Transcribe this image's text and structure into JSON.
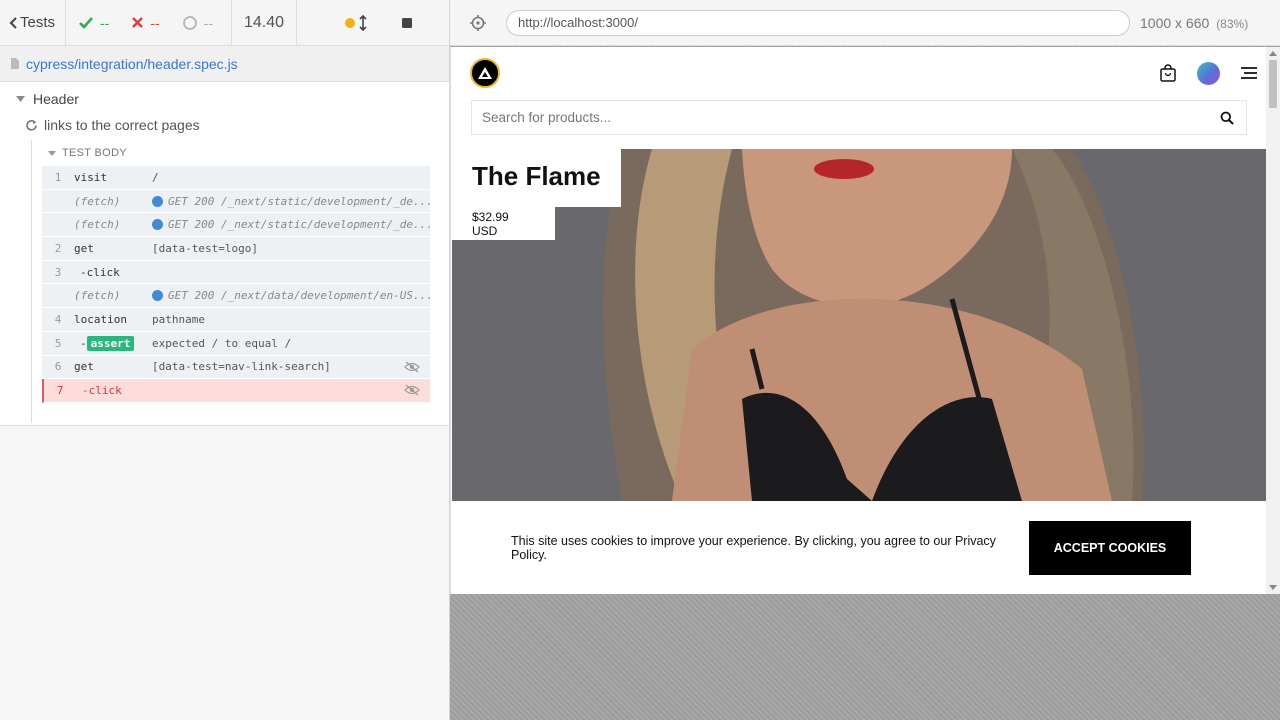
{
  "reporter": {
    "tests_label": "Tests",
    "passed": "--",
    "failed": "--",
    "pending": "--",
    "duration": "14.40",
    "spec_path": "cypress/integration/header.spec.js",
    "suite_title": "Header",
    "test_title": "links to the correct pages",
    "test_body_label": "TEST BODY",
    "commands": [
      {
        "num": "1",
        "name": "visit",
        "message": "/"
      },
      {
        "num": "",
        "name": "(fetch)",
        "message": "GET 200 /_next/static/development/_de..."
      },
      {
        "num": "",
        "name": "(fetch)",
        "message": "GET 200 /_next/static/development/_de..."
      },
      {
        "num": "2",
        "name": "get",
        "message": "[data-test=logo]"
      },
      {
        "num": "3",
        "name": "-click",
        "message": ""
      },
      {
        "num": "",
        "name": "(fetch)",
        "message": "GET 200 /_next/data/development/en-US..."
      },
      {
        "num": "4",
        "name": "location",
        "message": "pathname"
      },
      {
        "num": "5",
        "name": "-",
        "badge": "assert",
        "message": "expected / to equal /"
      },
      {
        "num": "6",
        "name": "get",
        "message": "[data-test=nav-link-search]"
      },
      {
        "num": "7",
        "name": "-click",
        "message": ""
      }
    ],
    "colors": {
      "pass": "#31a852",
      "fail": "#e33a3a",
      "link": "#3a76d3",
      "failed_row": "#fddcdc"
    }
  },
  "aut": {
    "url": "http://localhost:3000/",
    "viewport": "1000 x 660",
    "scale": "(83%)",
    "search_placeholder": "Search for products...",
    "product_title": "The Flame",
    "product_price": "$32.99 USD",
    "cookie_text": "This site uses cookies to improve your experience. By clicking, you agree to our Privacy Policy.",
    "accept_label": "ACCEPT COOKIES"
  }
}
